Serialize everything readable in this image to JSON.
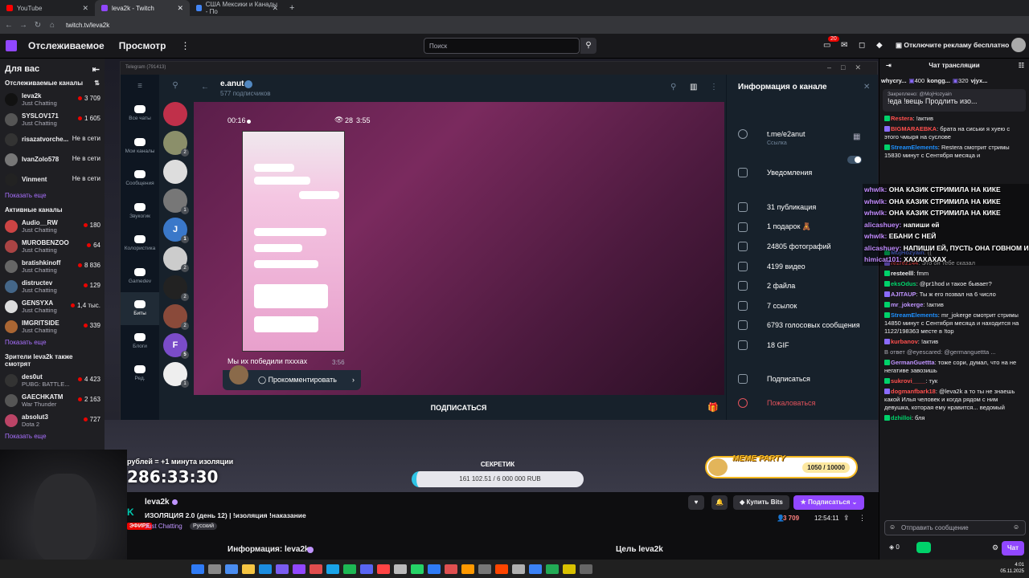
{
  "browser": {
    "tabs": [
      {
        "label": "YouTube",
        "color": "#ff0000"
      },
      {
        "label": "leva2k - Twitch",
        "color": "#9147ff"
      },
      {
        "label": "США Мексики и Канады - По",
        "color": "#4285f4"
      }
    ],
    "url": "twitch.tv/leva2k"
  },
  "topnav": {
    "following": "Отслеживаемое",
    "browse": "Просмотр",
    "search_placeholder": "Поиск",
    "notif_badge": "20",
    "adfree": "Отключите рекламу бесплатно"
  },
  "sidebar": {
    "for_you": "Для вас",
    "followed_header": "Отслеживаемые каналы",
    "followed": [
      {
        "name": "leva2k",
        "game": "Just Chatting",
        "viewers": "3 709",
        "live": true,
        "color": "#111"
      },
      {
        "name": "SYSLOV171",
        "game": "Just Chatting",
        "viewers": "1 605",
        "live": true,
        "color": "#555"
      },
      {
        "name": "risazatvorche...",
        "game": "",
        "viewers": "Не в сети",
        "live": false,
        "color": "#333"
      },
      {
        "name": "IvanZolo578",
        "game": "",
        "viewers": "Не в сети",
        "live": false,
        "color": "#777"
      },
      {
        "name": "Vinment",
        "game": "",
        "viewers": "Не в сети",
        "live": false,
        "color": "#222"
      }
    ],
    "show_more_1": "Показать еще",
    "active_header": "Активные каналы",
    "active": [
      {
        "name": "Audio__RW",
        "game": "Just Chatting",
        "viewers": "180",
        "color": "#c44"
      },
      {
        "name": "MUROBENZOO",
        "game": "Just Chatting",
        "viewers": "64",
        "color": "#a44"
      },
      {
        "name": "bratishkinoff",
        "game": "Just Chatting",
        "viewers": "8 836",
        "color": "#666"
      },
      {
        "name": "distructev",
        "game": "Just Chatting",
        "viewers": "129",
        "color": "#468"
      },
      {
        "name": "GENSYXA",
        "game": "Just Chatting",
        "viewers": "1,4 тыс.",
        "color": "#ddd"
      },
      {
        "name": "IMGRITSIDE",
        "game": "Just Chatting",
        "viewers": "339",
        "color": "#a63"
      }
    ],
    "show_more_2": "Показать еще",
    "also_header": "Зрители leva2k также смотрят",
    "also": [
      {
        "name": "des0ut",
        "game": "PUBG: BATTLE...",
        "viewers": "4 423",
        "color": "#333"
      },
      {
        "name": "GAECHKATM",
        "game": "War Thunder",
        "viewers": "2 163",
        "color": "#555"
      },
      {
        "name": "absolut3",
        "game": "Dota 2",
        "viewers": "727",
        "color": "#b46"
      }
    ],
    "show_more_3": "Показать еще"
  },
  "telegram": {
    "window_title": "Telegram (791413)",
    "folders": [
      {
        "label": "Все чаты",
        "selected": false
      },
      {
        "label": "Мои каналы",
        "selected": false
      },
      {
        "label": "Сообщения",
        "selected": false
      },
      {
        "label": "Звукогик",
        "selected": false
      },
      {
        "label": "Колористика",
        "selected": false
      },
      {
        "label": "Gamedev",
        "selected": false
      },
      {
        "label": "Биты",
        "selected": true
      },
      {
        "label": "Блоги",
        "selected": false
      },
      {
        "label": "Ред.",
        "selected": false
      }
    ],
    "channel_name": "e.anut",
    "subscribers": "577 подписчиков",
    "video_time": "00:16",
    "video_views": "28",
    "video_clock": "3:55",
    "post_time": "3:56",
    "caption": "Мы их победили пхххах",
    "comment_label": "Прокомментировать",
    "subscribe_label": "ПОДПИСАТЬСЯ",
    "info_title": "Информация о канале",
    "link": "t.me/e2anut",
    "link_label": "Ссылка",
    "notifications": "Уведомления",
    "stats": [
      "31 публикация",
      "1 подарок 🧸",
      "24805 фотографий",
      "4199 видео",
      "2 файла",
      "7 ссылок",
      "6793 голосовых сообщения",
      "18 GIF"
    ],
    "subscribe_action": "Подписаться",
    "report_action": "Пожаловаться"
  },
  "stream_overlay": {
    "timer_label": "рублей = +1 минута изоляции",
    "timer": "286:33:30",
    "goal_title": "СЕКРЕТИК",
    "goal_value": "161 102.51 / 6 000 000 RUB",
    "meme_label": "MEME PARTY",
    "meme_count": "1050 / 10000"
  },
  "streaminfo": {
    "streamer": "leva2k",
    "title": "ИЗОЛЯЦИЯ 2.0 (день 12) | !изоляция !наказание",
    "live": "ЭФИРЕ",
    "category": "Just Chatting",
    "language": "Русский",
    "bits_label": "Купить Bits",
    "subscribe_label": "Подписаться",
    "viewers": "3 709",
    "uptime": "12:54:11",
    "about": "Информация: leva2k",
    "goals": "Цель leva2k"
  },
  "chat": {
    "header": "Чат трансляции",
    "gifts": [
      {
        "name": "whycry...",
        "count": ""
      },
      {
        "name": "",
        "count": "400"
      },
      {
        "name": "kongg...",
        "count": ""
      },
      {
        "name": "",
        "count": "320"
      },
      {
        "name": "vjyx...",
        "count": ""
      }
    ],
    "pinned_label": "Закреплено: @MojHozyain",
    "pinned_text": "!еда !вещь Продлить изо...",
    "messages": [
      {
        "user": "Restera",
        "color": "#ff4f4d",
        "text": "!актив"
      },
      {
        "user": "BIGMARAEBKA",
        "color": "#ff4f4d",
        "text": "брата на сиськи я хуею с этого чмыря на суслове"
      },
      {
        "user": "StreamElements",
        "color": "#1e90ff",
        "text": "Restera смотрит стримы 15830 минут с Сентября месяца и"
      },
      {
        "user": "MojHozyain",
        "color": "#5b7dff",
        "text": "(("
      },
      {
        "user": "rezrez144",
        "color": "#ff4f4d",
        "text": "Это он тебе сказал"
      },
      {
        "user": "resteelll",
        "color": "#efeff1",
        "text": "fmm"
      },
      {
        "user": "eksOdus",
        "color": "#00d26a",
        "text": "@pr1hod и такое бывает?"
      },
      {
        "user": "AJITAUP",
        "color": "#bf94ff",
        "text": "Ты ж его позвал на 6 число"
      },
      {
        "user": "mr_jokerge",
        "color": "#bf94ff",
        "text": "!актив"
      },
      {
        "user": "StreamElements",
        "color": "#1e90ff",
        "text": "mr_jokerge смотрит стримы 14850 минут с Сентября месяца и находится на 1122/198363 месте в !top"
      },
      {
        "user": "kurbanov",
        "color": "#ff4f4d",
        "text": "!актив"
      },
      {
        "user": "GermanGuettta",
        "color": "#bf94ff",
        "text": "тоже сори, думал, что на не негативе завозишь",
        "reply": "В ответ @eyescared: @germanguettta ..."
      },
      {
        "user": "sukrovi____",
        "color": "#ff4f4d",
        "text": "тук"
      },
      {
        "user": "dogmanfbark18",
        "color": "#ff4f4d",
        "text": "@leva2k а то ты не знаешь какой Илья человек и когда рядом с ним девушка, которая ему нравится... ведомый"
      },
      {
        "user": "dzhilloi",
        "color": "#00d26a",
        "text": "бля"
      }
    ],
    "overlay": [
      {
        "user": "whwlk:",
        "text": "ОНА КАЗИК СТРИМИЛА НА КИКЕ"
      },
      {
        "user": "whwlk:",
        "text": "ОНА КАЗИК СТРИМИЛА НА КИКЕ"
      },
      {
        "user": "whwlk:",
        "text": "ОНА КАЗИК СТРИМИЛА НА КИКЕ"
      },
      {
        "user": "alicashuey:",
        "text": "напиши ей"
      },
      {
        "user": "whwlk:",
        "text": "ЕБАНИ С НЕЙ"
      },
      {
        "user": "alicashuey:",
        "text": "НАПИШИ ЕЙ, ПУСТЬ ОНА ГОВНОМ ИЗМАЖЕТ"
      },
      {
        "user": "himicat101:",
        "text": "ХАХАХАХАХ"
      }
    ],
    "input_placeholder": "Отправить сообщение",
    "points": "0",
    "chat_button": "Чат"
  },
  "taskbar": {
    "time": "4:01",
    "date": "05.11.2025"
  }
}
